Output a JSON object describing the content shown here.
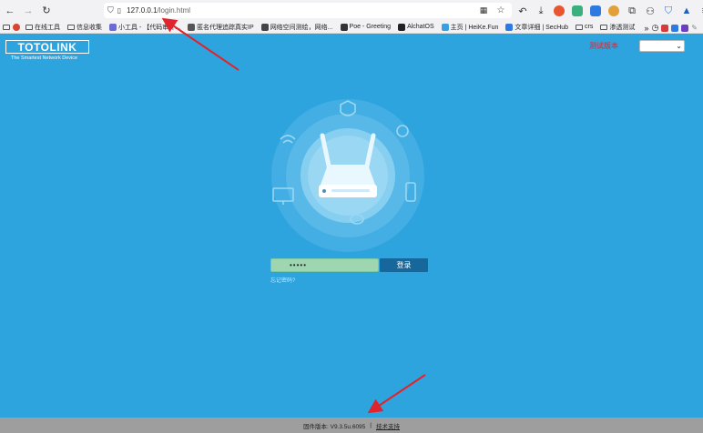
{
  "browser": {
    "url_host": "127.0.0.1",
    "url_path": "/login.html",
    "bookmarks": [
      {
        "label": "在线工具",
        "kind": "folder"
      },
      {
        "label": "信息收集",
        "kind": "folder"
      },
      {
        "label": "小工具 - 【代码审计...",
        "kind": "favicon",
        "color": "#6b6bd6"
      },
      {
        "label": "匿名代理追踪真实IP",
        "kind": "favicon",
        "color": "#555555"
      },
      {
        "label": "网络空间测绘，网络...",
        "kind": "favicon",
        "color": "#444444"
      },
      {
        "label": "Poe - Greeting",
        "kind": "favicon",
        "color": "#333333"
      },
      {
        "label": "AlchatOS",
        "kind": "favicon",
        "color": "#222222"
      },
      {
        "label": "主页 | HeiKe.Fun",
        "kind": "favicon",
        "color": "#3aa0e0"
      },
      {
        "label": "文章详细 | SecHub",
        "kind": "favicon",
        "color": "#2c7be5"
      },
      {
        "label": "crs",
        "kind": "folder"
      },
      {
        "label": "渗透测试",
        "kind": "folder"
      }
    ]
  },
  "header": {
    "logo_text": "TOTOLINK",
    "logo_tagline": "The Smartest Network Device",
    "test_version": "测试版本",
    "language_selected": ""
  },
  "login": {
    "password_value": "•••••",
    "login_label": "登录",
    "forgot_label": "忘记密码?"
  },
  "footer": {
    "firmware_label": "固件版本: V9.3.5u.6095",
    "separator": "|",
    "support_label": "技术支持"
  },
  "colors": {
    "page_background": "#2ea4de",
    "login_button": "#15679c",
    "password_field": "#9dd6b0",
    "footer_background": "#9e9e9e",
    "annotation_arrow": "#e0232c"
  }
}
